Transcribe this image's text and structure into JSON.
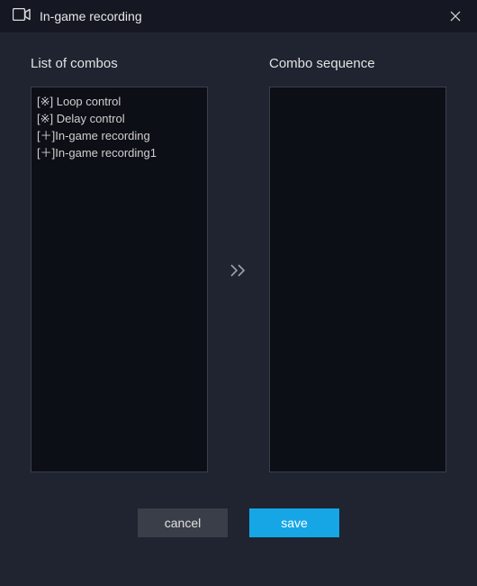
{
  "window": {
    "title": "In-game recording"
  },
  "labels": {
    "list_of_combos": "List of combos",
    "combo_sequence": "Combo sequence"
  },
  "combos": [
    {
      "prefix": "[※] ",
      "name": "Loop control"
    },
    {
      "prefix": "[※] ",
      "name": "Delay control"
    },
    {
      "prefix": "[＋]",
      "name": "In-game recording"
    },
    {
      "prefix": "[＋]",
      "name": "In-game recording1"
    }
  ],
  "sequence": [],
  "buttons": {
    "cancel": "cancel",
    "save": "save"
  },
  "icons": {
    "title_icon": "camera-icon",
    "close": "close-icon",
    "transfer": "double-chevron-right-icon"
  }
}
